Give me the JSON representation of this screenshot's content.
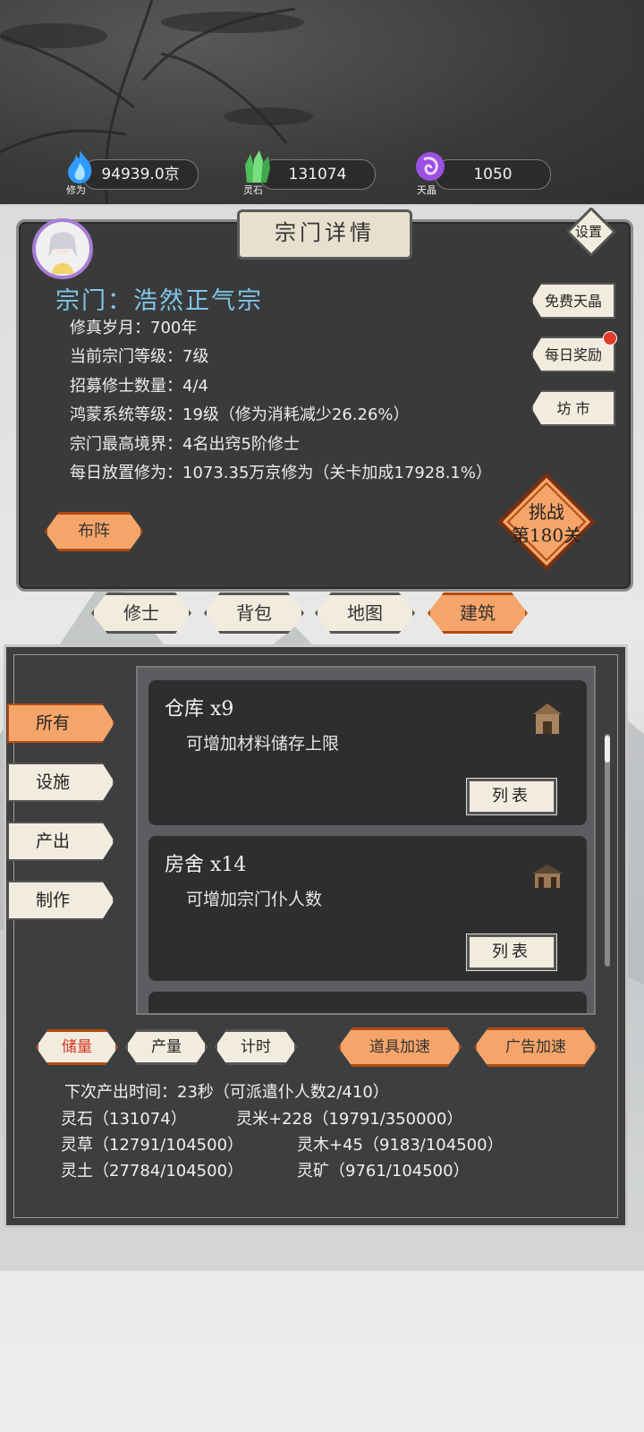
{
  "resources": [
    {
      "name": "修为",
      "value": "94939.0京",
      "color": "#3fb4ff",
      "icon": "blue-flame-icon"
    },
    {
      "name": "灵石",
      "value": "131074",
      "color": "#5ecf6a",
      "icon": "green-crystal-icon"
    },
    {
      "name": "天晶",
      "value": "1050",
      "color": "#b06bf2",
      "icon": "purple-gem-icon"
    }
  ],
  "header": {
    "title": "宗门详情",
    "settings_label": "设置"
  },
  "sect": {
    "name": "宗门：浩然正气宗",
    "lines": [
      "修真岁月：700年",
      "当前宗门等级：7级",
      "招募修士数量：4/4",
      "鸿蒙系统等级：19级（修为消耗减少26.26%）",
      "宗门最高境界：4名出窍5阶修士",
      "每日放置修为：1073.35万京修为（关卡加成17928.1%）"
    ]
  },
  "side_buttons": [
    {
      "label": "免费天晶"
    },
    {
      "label": "每日奖励"
    },
    {
      "label": "坊 市"
    }
  ],
  "formation_label": "布阵",
  "challenge": {
    "line1": "挑战",
    "line2": "第180关"
  },
  "main_tabs": [
    {
      "label": "修士"
    },
    {
      "label": "背包"
    },
    {
      "label": "地图"
    },
    {
      "label": "建筑"
    }
  ],
  "categories": [
    {
      "label": "所有"
    },
    {
      "label": "设施"
    },
    {
      "label": "产出"
    },
    {
      "label": "制作"
    }
  ],
  "buildings": [
    {
      "title": "仓库 x9",
      "desc": "可增加材料储存上限",
      "button": "列表"
    },
    {
      "title": "房舍 x14",
      "desc": "可增加宗门仆人数",
      "button": "列表"
    }
  ],
  "bottom_tabs": [
    {
      "label": "储量"
    },
    {
      "label": "产量"
    },
    {
      "label": "计时"
    }
  ],
  "speed_buttons": [
    {
      "label": "道具加速"
    },
    {
      "label": "广告加速"
    }
  ],
  "stats": {
    "next_output": "下次产出时间：23秒（可派遣仆人数2/410）",
    "lingshi": "灵石（131074）",
    "lingmi": "灵米+228（19791/350000）",
    "lingcao": "灵草（12791/104500）",
    "lingmu": "灵木+45（9183/104500）",
    "lingtu": "灵土（27784/104500）",
    "lingkuang": "灵矿（9761/104500）"
  }
}
